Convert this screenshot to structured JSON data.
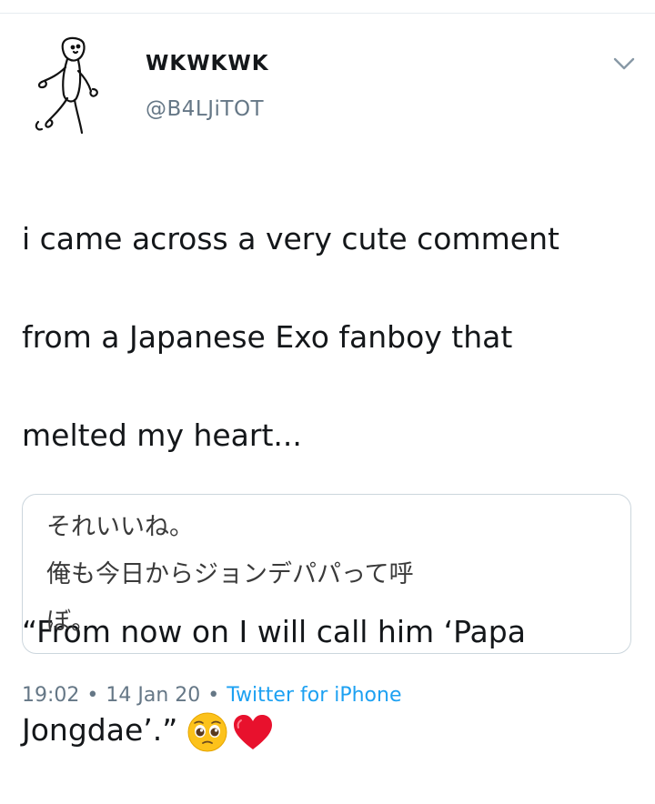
{
  "tweet": {
    "display_name": "WKWKWK",
    "handle": "@B4LJiTOT",
    "text_lines": [
      "i came across a very cute comment",
      "from a Japanese Exo fanboy that",
      "melted my heart...",
      "",
      "“From now on I will call him ‘Papa",
      "Jongdae’.”"
    ],
    "emoji": [
      "pleading-face",
      "red-heart"
    ],
    "quote_lines": [
      "それいいね。",
      "俺も今日からジョンデパパって呼",
      "ぼ。"
    ],
    "time": "19:02",
    "date": "14 Jan 20",
    "source": "Twitter for iPhone",
    "separator": "•"
  },
  "colors": {
    "text": "#14171a",
    "secondary": "#657786",
    "link": "#1da1f2",
    "border": "#ccd6dd"
  }
}
